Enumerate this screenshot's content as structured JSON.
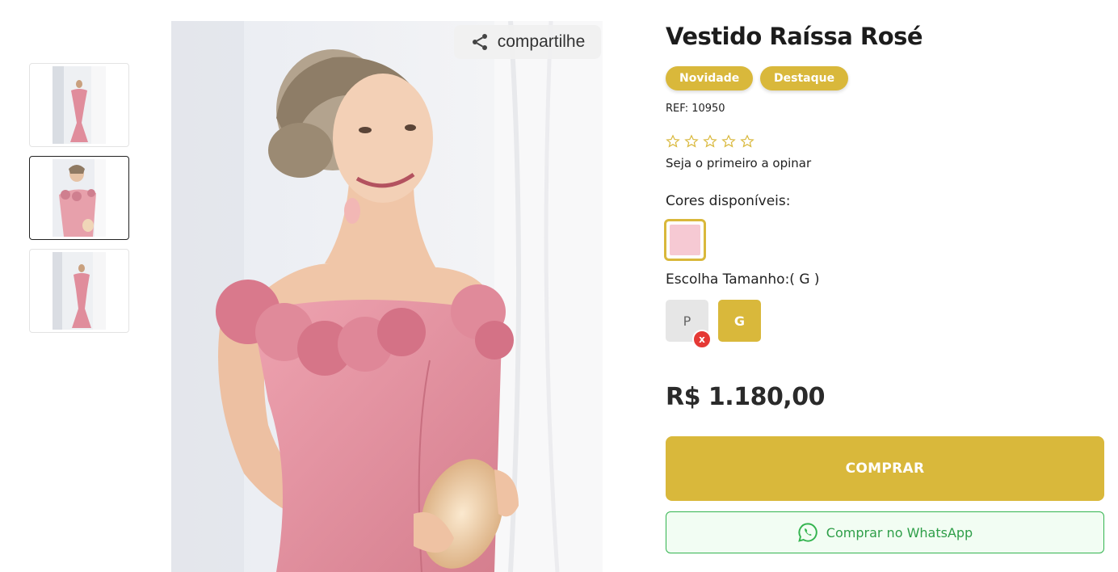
{
  "product": {
    "title": "Vestido Raíssa Rosé",
    "badges": [
      "Novidade",
      "Destaque"
    ],
    "ref": "REF: 10950",
    "rating": {
      "stars": 0,
      "max": 5,
      "prompt": "Seja o primeiro a opinar"
    },
    "colors": {
      "label": "Cores disponíveis:",
      "options": [
        {
          "color": "#f6c9d3",
          "selected": true
        }
      ]
    },
    "sizes": {
      "label": "Escolha Tamanho:( G )",
      "options": [
        {
          "label": "P",
          "available": false,
          "unavailable_mark": "x"
        },
        {
          "label": "G",
          "available": true,
          "selected": true
        }
      ]
    },
    "price": "R$ 1.180,00",
    "buy_label": "COMPRAR",
    "whatsapp_label": "Comprar no WhatsApp"
  },
  "gallery": {
    "share_label": "compartilhe",
    "thumbnails": [
      "full-length-photo",
      "portrait-photo",
      "full-length-photo"
    ],
    "active_thumbnail": 1
  },
  "colors": {
    "accent": "#d9b83b",
    "whatsapp": "#33b44f",
    "unavailable": "#e53935",
    "dress": "#e8919f"
  },
  "icons": [
    "share-icon",
    "star-outline-icon",
    "whatsapp-icon"
  ]
}
